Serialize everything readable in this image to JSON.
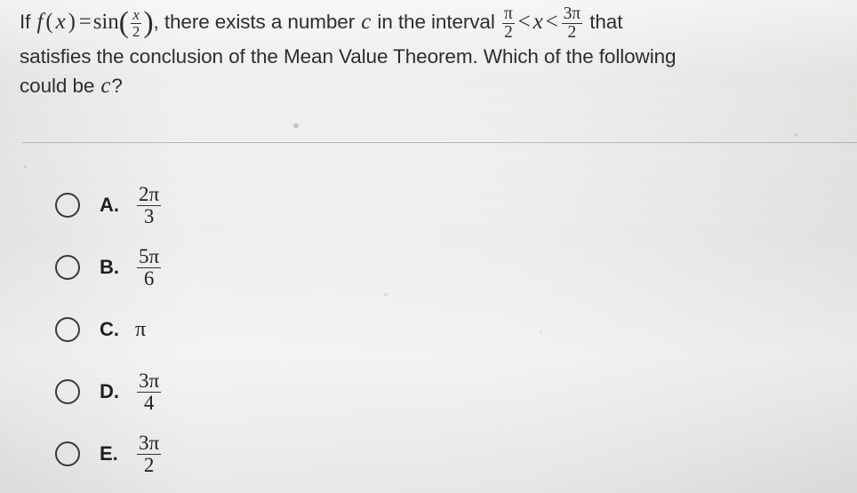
{
  "question": {
    "line1_pre": "If ",
    "f": "f",
    "open_paren": "(",
    "var_x": "x",
    "close_paren": ")",
    "equals": "=",
    "sin": "sin",
    "arg_num": "x",
    "arg_den": "2",
    "line1_mid": ", there exists a number ",
    "var_c": "c",
    "line1_post": " in the interval ",
    "lower_num": "π",
    "lower_den": "2",
    "lt1": "<",
    "ineq_var": "x",
    "lt2": "<",
    "upper_num": "3π",
    "upper_den": "2",
    "line1_end": " that",
    "line2": "satisfies the conclusion of the Mean Value Theorem. Which of the following",
    "line3_pre": "could be ",
    "line3_var": "c",
    "line3_post": "?"
  },
  "choices": [
    {
      "letter": "A.",
      "kind": "fraction",
      "numerator": "2π",
      "denominator": "3",
      "text": "2π/3",
      "selected": false
    },
    {
      "letter": "B.",
      "kind": "fraction",
      "numerator": "5π",
      "denominator": "6",
      "text": "5π/6",
      "selected": false
    },
    {
      "letter": "C.",
      "kind": "plain",
      "numerator": "",
      "denominator": "",
      "text": "π",
      "selected": false
    },
    {
      "letter": "D.",
      "kind": "fraction",
      "numerator": "3π",
      "denominator": "4",
      "text": "3π/4",
      "selected": false
    },
    {
      "letter": "E.",
      "kind": "fraction",
      "numerator": "3π",
      "denominator": "2",
      "text": "3π/2",
      "selected": false
    }
  ],
  "colors": {
    "background": "#e9eae7",
    "text": "#2e2e2e",
    "divider": "#a9aba7",
    "radio_outline": "#3a3a3a"
  }
}
